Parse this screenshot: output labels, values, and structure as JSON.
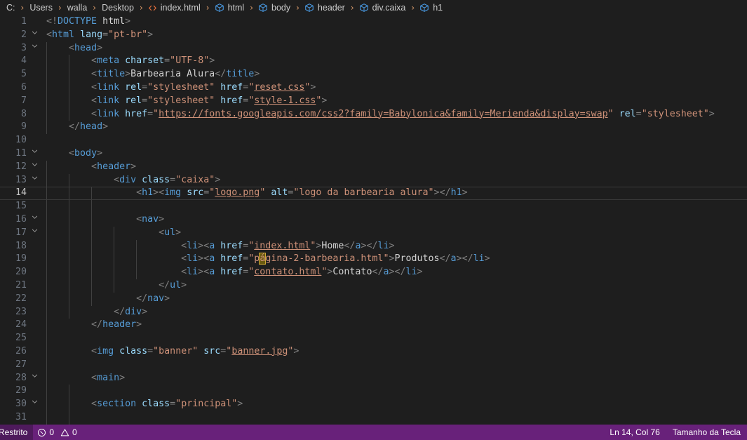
{
  "breadcrumb": {
    "name": "breadcrumb-path",
    "items": [
      {
        "label": "C:",
        "icon": "none"
      },
      {
        "label": "Users",
        "icon": "none"
      },
      {
        "label": "walla",
        "icon": "none"
      },
      {
        "label": "Desktop",
        "icon": "none"
      },
      {
        "label": "index.html",
        "icon": "code-file-icon"
      },
      {
        "label": "html",
        "icon": "symbol-field-icon"
      },
      {
        "label": "body",
        "icon": "symbol-field-icon"
      },
      {
        "label": "header",
        "icon": "symbol-field-icon"
      },
      {
        "label": "div.caixa",
        "icon": "symbol-field-icon"
      },
      {
        "label": "h1",
        "icon": "symbol-field-icon"
      }
    ],
    "separator": "›"
  },
  "editor": {
    "language": "html",
    "active_line": 14,
    "fold_chevron": "⌄",
    "lines": [
      {
        "n": 1,
        "fold": false,
        "guides": 0,
        "text": "<!DOCTYPE html>"
      },
      {
        "n": 2,
        "fold": true,
        "guides": 0,
        "text": "<html lang=\"pt-br\">"
      },
      {
        "n": 3,
        "fold": true,
        "guides": 1,
        "text": "    <head>"
      },
      {
        "n": 4,
        "fold": false,
        "guides": 2,
        "text": "        <meta charset=\"UTF-8\">"
      },
      {
        "n": 5,
        "fold": false,
        "guides": 2,
        "text": "        <title>Barbearia Alura</title>"
      },
      {
        "n": 6,
        "fold": false,
        "guides": 2,
        "text": "        <link rel=\"stylesheet\" href=\"reset.css\">"
      },
      {
        "n": 7,
        "fold": false,
        "guides": 2,
        "text": "        <link rel=\"stylesheet\" href=\"style-1.css\">"
      },
      {
        "n": 8,
        "fold": false,
        "guides": 2,
        "text": "        <link href=\"https://fonts.googleapis.com/css2?family=Babylonica&family=Merienda&display=swap\" rel=\"stylesheet\">"
      },
      {
        "n": 9,
        "fold": false,
        "guides": 1,
        "text": "    </head>"
      },
      {
        "n": 10,
        "fold": false,
        "guides": 0,
        "text": ""
      },
      {
        "n": 11,
        "fold": true,
        "guides": 0,
        "text": "    <body>"
      },
      {
        "n": 12,
        "fold": true,
        "guides": 1,
        "text": "        <header>"
      },
      {
        "n": 13,
        "fold": true,
        "guides": 2,
        "text": "            <div class=\"caixa\">"
      },
      {
        "n": 14,
        "fold": false,
        "guides": 3,
        "text": "                <h1><img src=\"logo.png\" alt=\"logo da barbearia alura\"></h1>"
      },
      {
        "n": 15,
        "fold": false,
        "guides": 3,
        "text": ""
      },
      {
        "n": 16,
        "fold": true,
        "guides": 3,
        "text": "                <nav>"
      },
      {
        "n": 17,
        "fold": true,
        "guides": 4,
        "text": "                    <ul>"
      },
      {
        "n": 18,
        "fold": false,
        "guides": 5,
        "text": "                        <li><a href=\"index.html\">Home</a></li>"
      },
      {
        "n": 19,
        "fold": false,
        "guides": 5,
        "text": "                        <li><a href=\"página-2-barbearia.html\">Produtos</a></li>"
      },
      {
        "n": 20,
        "fold": false,
        "guides": 5,
        "text": "                        <li><a href=\"contato.html\">Contato</a></li>"
      },
      {
        "n": 21,
        "fold": false,
        "guides": 4,
        "text": "                    </ul>"
      },
      {
        "n": 22,
        "fold": false,
        "guides": 3,
        "text": "                </nav>"
      },
      {
        "n": 23,
        "fold": false,
        "guides": 2,
        "text": "            </div>"
      },
      {
        "n": 24,
        "fold": false,
        "guides": 1,
        "text": "        </header>"
      },
      {
        "n": 25,
        "fold": false,
        "guides": 1,
        "text": ""
      },
      {
        "n": 26,
        "fold": false,
        "guides": 1,
        "text": "        <img class=\"banner\" src=\"banner.jpg\">"
      },
      {
        "n": 27,
        "fold": false,
        "guides": 1,
        "text": ""
      },
      {
        "n": 28,
        "fold": true,
        "guides": 1,
        "text": "        <main>"
      },
      {
        "n": 29,
        "fold": false,
        "guides": 2,
        "text": ""
      },
      {
        "n": 30,
        "fold": true,
        "guides": 2,
        "text": "        <section class=\"principal\">"
      },
      {
        "n": 31,
        "fold": false,
        "guides": 2,
        "text": ""
      }
    ]
  },
  "statusbar": {
    "trust_label": "Restrito",
    "errors_icon": "error-circle-icon",
    "errors_count": "0",
    "warnings_icon": "warning-triangle-icon",
    "warnings_count": "0",
    "cursor_position": "Ln 14, Col 76",
    "key_size": "Tamanho da Tecla",
    "background_color": "#68217a"
  },
  "colors": {
    "editor_background": "#1e1e1e",
    "tag": "#569cd6",
    "attribute": "#9cdcfe",
    "string": "#ce9178",
    "bracket": "#808080",
    "text": "#d4d4d4",
    "line_number": "#6e7681",
    "line_number_active": "#c6c6c6",
    "indent_guide": "#404040",
    "unicode_highlight": "#cda832"
  }
}
